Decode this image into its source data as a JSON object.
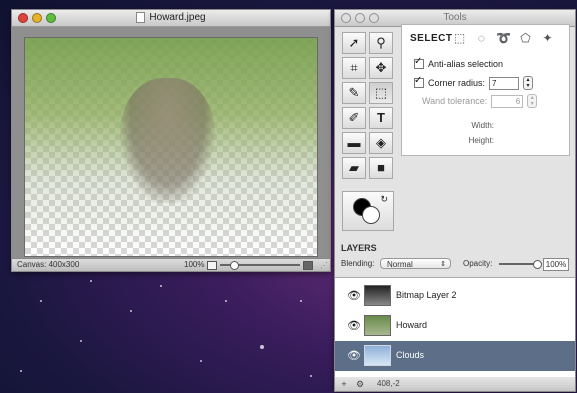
{
  "image_window": {
    "title": "Howard.jpeg",
    "status_canvas": "Canvas: 400x300",
    "status_zoom": "100%"
  },
  "tools_window": {
    "title": "Tools",
    "tool_icons": [
      "select-arrow-icon",
      "magnifier-icon",
      "crop-icon",
      "move-icon",
      "brush-icon",
      "marquee-icon",
      "eraser-icon",
      "text-icon",
      "rectangle-icon",
      "paint-bucket-icon",
      "gradient-icon",
      "shape-icon",
      "color-swap-icon"
    ],
    "select_panel": {
      "heading": "SELECT",
      "antialias_label": "Anti-alias selection",
      "antialias_checked": true,
      "corner_radius_label": "Corner radius:",
      "corner_radius_checked": true,
      "corner_radius_value": "7",
      "wand_tolerance_label": "Wand tolerance:",
      "wand_tolerance_value": "6",
      "width_label": "Width:",
      "height_label": "Height:"
    },
    "layers": {
      "title": "LAYERS",
      "blending_label": "Blending:",
      "blending_value": "Normal",
      "opacity_label": "Opacity:",
      "opacity_value": "100%",
      "items": [
        {
          "name": "Bitmap Layer 2",
          "selected": false
        },
        {
          "name": "Howard",
          "selected": false
        },
        {
          "name": "Clouds",
          "selected": true
        }
      ]
    },
    "bottom_bar": {
      "add_label": "+",
      "gear_label": "⚙",
      "coords": "408,-2"
    }
  },
  "colors": {
    "selected_layer": "#5c6e88",
    "traffic_red": "#e0443c",
    "traffic_yellow": "#e7b32b",
    "traffic_green": "#5ebf3f"
  }
}
